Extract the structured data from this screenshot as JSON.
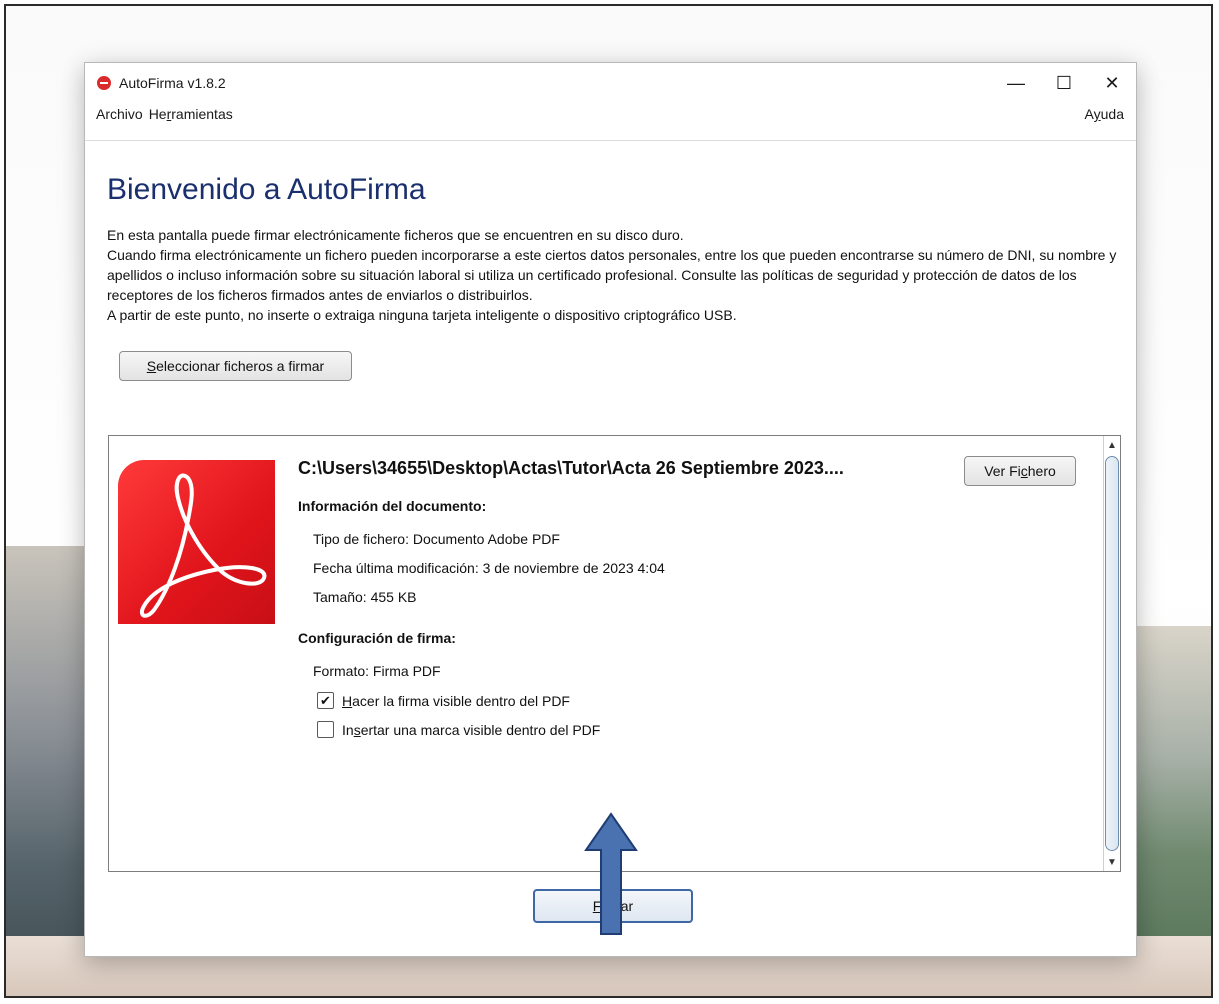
{
  "window": {
    "title": "AutoFirma v1.8.2",
    "minimize_glyph": "—",
    "maximize_glyph": "☐",
    "close_glyph": "✕"
  },
  "menu": {
    "file": "Archivo",
    "tools_pre": "He",
    "tools_mnemonic": "r",
    "tools_post": "ramientas",
    "help_pre": "A",
    "help_mnemonic": "y",
    "help_post": "uda"
  },
  "main": {
    "title": "Bienvenido a AutoFirma",
    "intro": [
      "En esta pantalla puede firmar electrónicamente ficheros que se encuentren en su disco duro.",
      "Cuando firma electrónicamente un fichero pueden incorporarse a este ciertos datos personales, entre los que pueden encontrarse su número de DNI, su nombre y apellidos o incluso información sobre su situación laboral si utiliza un certificado profesional. Consulte las políticas de seguridad y protección de datos de los receptores de los ficheros firmados antes de enviarlos o distribuirlos.",
      "A partir de este punto, no inserte o extraiga ninguna tarjeta inteligente o dispositivo criptográfico USB."
    ],
    "select_button_mnemonic": "S",
    "select_button_rest": "eleccionar ficheros a firmar"
  },
  "file": {
    "path": "C:\\Users\\34655\\Desktop\\Actas\\Tutor\\Acta 26 Septiembre 2023....",
    "view_button_pre": "Ver Fi",
    "view_button_mnemonic": "c",
    "view_button_post": "hero",
    "doc_info_heading": "Información del documento:",
    "type": "Tipo de fichero: Documento Adobe PDF",
    "modified": "Fecha última modificación: 3 de noviembre de 2023 4:04",
    "size": "Tamaño: 455 KB",
    "signature_heading": "Configuración de firma:",
    "format": "Formato: Firma PDF",
    "option_visible_sig": {
      "mnemonic": "H",
      "rest": "acer la firma visible dentro del PDF",
      "checked": true
    },
    "option_visible_mark": {
      "pre": "In",
      "mnemonic": "s",
      "rest": "ertar una marca visible dentro del PDF",
      "checked": false
    },
    "icon": "adobe-pdf-icon"
  },
  "footer": {
    "sign_button_mnemonic": "F",
    "sign_button_rest": "irmar"
  },
  "annotation": {
    "arrow_color": "#4a72b0",
    "arrow_outline": "#1f3d73"
  },
  "colors": {
    "title_blue": "#1a2f6e",
    "pdf_red": "#e0141b"
  }
}
